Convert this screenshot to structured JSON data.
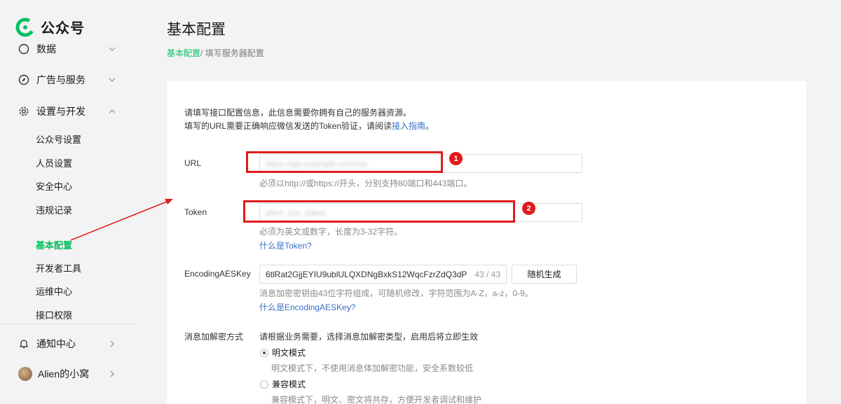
{
  "app": {
    "name": "公众号"
  },
  "sidebar": {
    "partial_item": "数据",
    "items": [
      {
        "label": "广告与服务",
        "icon": "compass-icon"
      },
      {
        "label": "设置与开发",
        "icon": "gear-icon"
      }
    ],
    "sub_items": [
      "公众号设置",
      "人员设置",
      "安全中心",
      "违规记录",
      "基本配置",
      "开发者工具",
      "运维中心",
      "接口权限"
    ],
    "active_sub_item": "基本配置",
    "notify": {
      "label": "通知中心",
      "icon": "bell-icon"
    },
    "account": {
      "label": "Alien的小窝"
    }
  },
  "main": {
    "title": "基本配置",
    "breadcrumb": {
      "parent": "基本配置",
      "separator": "/ ",
      "current": "填写服务器配置"
    },
    "intro": {
      "line1": "请填写接口配置信息，此信息需要你拥有自己的服务器资源。",
      "line2_prefix": "填写的URL需要正确响应微信发送的Token验证，请阅读",
      "line2_link": "接入指南",
      "line2_suffix": "。"
    },
    "url": {
      "label": "URL",
      "value": "https://api.example.com/wx",
      "hint": "必须以http://或https://开头，分别支持80端口和443端口。"
    },
    "token": {
      "label": "Token",
      "value": "alien_xxx_token",
      "hint": "必须为英文或数字，长度为3-32字符。",
      "help_link": "什么是Token?"
    },
    "aes": {
      "label": "EncodingAESKey",
      "value": "6tlRat2GjjEYIU9ublULQXDNgBxkS12WqcFzrZdQ3dP",
      "counter": "43 / 43",
      "generate_button": "随机生成",
      "hint": "消息加密密钥由43位字符组成，可随机修改，字符范围为A-Z，a-z，0-9。",
      "help_link": "什么是EncodingAESKey?"
    },
    "encrypt": {
      "label": "消息加解密方式",
      "desc": "请根据业务需要，选择消息加解密类型，启用后将立即生效",
      "options": [
        {
          "label": "明文模式",
          "desc": "明文模式下，不使用消息体加解密功能，安全系数较低",
          "checked": true
        },
        {
          "label": "兼容模式",
          "desc": "兼容模式下，明文、密文将共存，方便开发者调试和维护",
          "checked": false
        }
      ]
    }
  },
  "annotations": {
    "badge1": "1",
    "badge2": "2",
    "highlight_color": "#e01b1b"
  },
  "colors": {
    "accent": "#07c160",
    "link": "#3a6fc4"
  }
}
